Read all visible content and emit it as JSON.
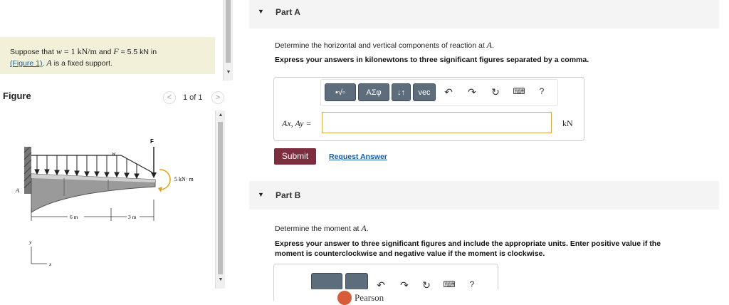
{
  "problem": {
    "intro": "Suppose that ",
    "w_sym": "w",
    "w_eq": " = 1 kN/m",
    "and": " and ",
    "F_sym": "F",
    "F_eq": " = 5.5 kN in",
    "figure_link": "(Figure 1)",
    "A_sym": "A",
    "tail": " is a fixed support."
  },
  "figure": {
    "title": "Figure",
    "pager": "1 of 1",
    "prev": "<",
    "next": ">",
    "labels": {
      "w": "w",
      "F": "F",
      "moment": "5 kN· m",
      "A": "A",
      "dim1": "6 m",
      "dim2": "3 m",
      "y": "y",
      "x": "x"
    }
  },
  "partA": {
    "title": "Part A",
    "prompt": "Determine the horizontal and vertical components of reaction at ",
    "prompt_sym": "A",
    "prompt_end": ".",
    "instruction": "Express your answers in kilonewtons to three significant figures separated by a comma.",
    "toolbar": {
      "templates": "▪√▫",
      "greek": "ΑΣφ",
      "arrows": "↓↑",
      "vec": "vec",
      "undo": "↶",
      "redo": "↷",
      "reset": "↻",
      "keyboard": "⌨",
      "help": "?"
    },
    "input_label": "Ax, Ay =",
    "input_value": "",
    "unit": "kN",
    "submit": "Submit",
    "request": "Request Answer"
  },
  "partB": {
    "title": "Part B",
    "prompt": "Determine the moment at ",
    "prompt_sym": "A",
    "prompt_end": ".",
    "instruction_1": "Express your answer to three significant figures and include the appropriate units. Enter positive value if the",
    "instruction_2": "moment is counterclockwise and negative value if the moment is clockwise.",
    "toolbar": {
      "undo": "↶",
      "redo": "↷",
      "reset": "↻",
      "keyboard": "⌨",
      "help": "?"
    }
  },
  "footer": {
    "brand": "Pearson"
  },
  "colors": {
    "problem_bg": "#f2f0d8",
    "submit": "#7d2e3e",
    "toolbar": "#5e6d7c",
    "input_border": "#d8a84a",
    "link": "#1a5ca0"
  }
}
